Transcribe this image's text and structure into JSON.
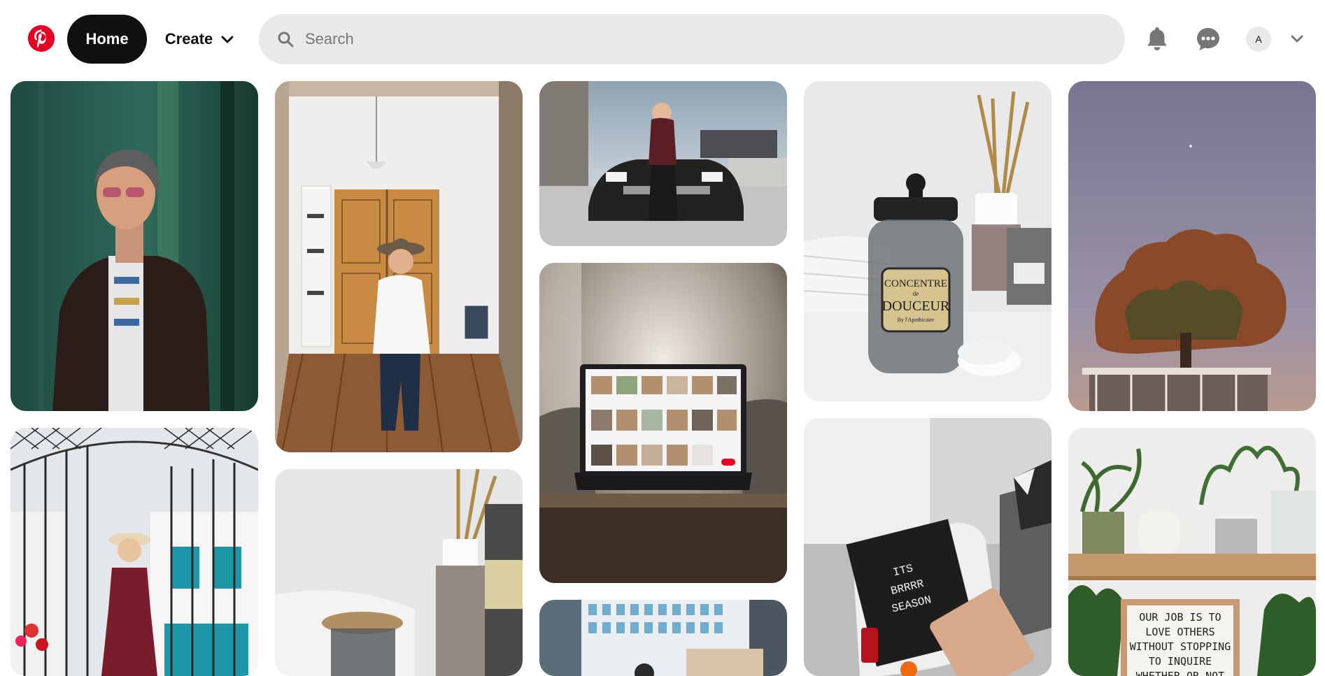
{
  "app": {
    "brand_color": "#e60023",
    "logo_icon": "pinterest-logo-icon"
  },
  "header": {
    "home_label": "Home",
    "create_label": "Create",
    "search_placeholder": "Search",
    "search_value": "",
    "avatar_initial": "A",
    "icons": [
      "search-icon",
      "bell-icon",
      "chat-icon",
      "chevron-down-icon"
    ]
  },
  "pins": [
    {
      "id": "man-leather-jacket",
      "column": 1
    },
    {
      "id": "woman-iron-gate",
      "column": 1
    },
    {
      "id": "woman-doorway-hat",
      "column": 2
    },
    {
      "id": "jar-diffuser-2",
      "column": 2
    },
    {
      "id": "woman-sports-car",
      "column": 3
    },
    {
      "id": "laptop-on-desk",
      "column": 3
    },
    {
      "id": "office-building",
      "column": 3
    },
    {
      "id": "concentre-jar",
      "column": 4,
      "label_lines": [
        "CONCENTRE",
        "de",
        "DOUCEUR",
        "By l'Apothicaire"
      ]
    },
    {
      "id": "letterboard-desk",
      "column": 4,
      "letterboard_lines": [
        "ITS",
        "BRRRR",
        "SEASON"
      ]
    },
    {
      "id": "tree-dusk",
      "column": 5
    },
    {
      "id": "plants-shelf",
      "column": 5,
      "sign_lines": [
        "OUR JOB IS TO",
        "LOVE OTHERS",
        "WITHOUT STOPPING",
        "TO INQUIRE",
        "WHETHER OR NOT"
      ]
    }
  ]
}
